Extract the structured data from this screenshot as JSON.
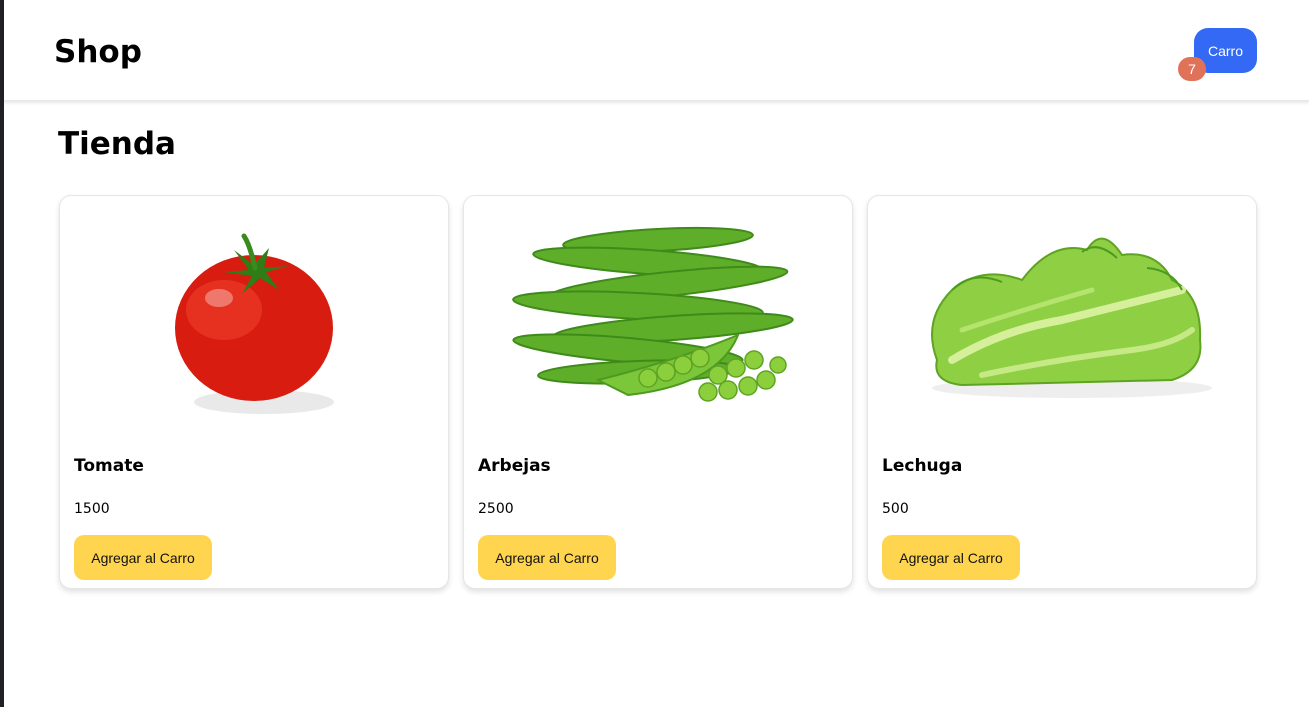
{
  "header": {
    "brand": "Shop",
    "cart_label": "Carro",
    "cart_count": "7"
  },
  "main": {
    "title": "Tienda",
    "products": [
      {
        "name": "Tomate",
        "price": "1500",
        "button_label": "Agregar al Carro",
        "image_icon": "tomato-image"
      },
      {
        "name": "Arbejas",
        "price": "2500",
        "button_label": "Agregar al Carro",
        "image_icon": "peas-image"
      },
      {
        "name": "Lechuga",
        "price": "500",
        "button_label": "Agregar al Carro",
        "image_icon": "lettuce-image"
      }
    ]
  },
  "colors": {
    "cart_button": "#3369f5",
    "cart_badge": "#e1725a",
    "add_button": "#ffd54f"
  }
}
